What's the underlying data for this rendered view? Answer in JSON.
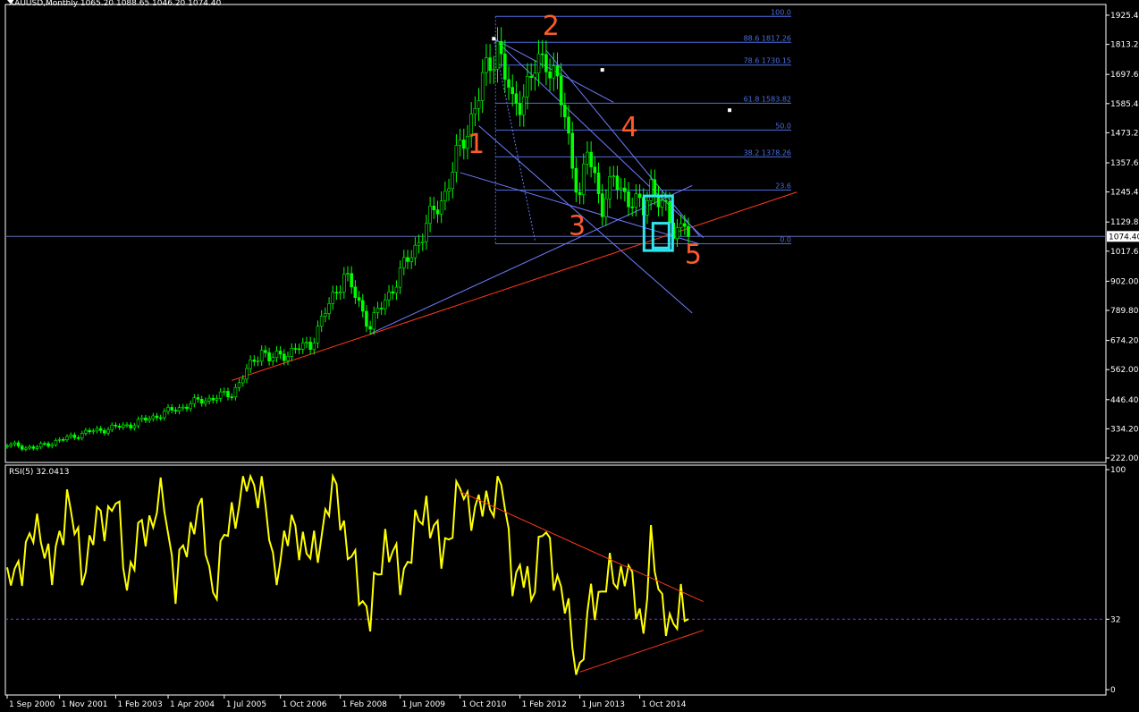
{
  "header": {
    "symbol_line": "XAUUSD,Monthly  1065.20 1088.65 1046.20 1074.40",
    "rsi_line": "RSI(5) 32.0413"
  },
  "colors": {
    "background": "#000000",
    "grid_and_axis": "#ffffff",
    "bull_candle": "#00ff00",
    "bear_candle": "#00ff00",
    "fib_lines": "#4a6ee0",
    "trend_lines": "#6f7dff",
    "support_line": "#ff3a1a",
    "rsi_line": "#ffff00",
    "rsi_trend_lines": "#ff3a1a",
    "wave_labels": "#ff5a2a",
    "highlight_boxes": "#2ee6f0",
    "price_marker_bg": "#ffffff",
    "price_marker_text": "#000000"
  },
  "chart_data": [
    {
      "type": "candlestick",
      "symbol": "XAUUSD",
      "timeframe": "Monthly",
      "current": {
        "open": 1065.2,
        "high": 1088.65,
        "low": 1046.2,
        "close": 1074.4
      },
      "y_ticks": [
        "1925.40",
        "1813.20",
        "1697.60",
        "1585.40",
        "1473.20",
        "1357.60",
        "1245.40",
        "1129.80",
        "1017.60",
        "902.00",
        "789.80",
        "674.20",
        "562.00",
        "446.40",
        "334.20",
        "222.00"
      ],
      "price_marker": "1074.40",
      "x_ticks": [
        "1 Sep 2000",
        "1 Nov 2001",
        "1 Feb 2003",
        "1 Apr 2004",
        "1 Jul 2005",
        "1 Oct 2006",
        "1 Feb 2008",
        "1 Jun 2009",
        "1 Oct 2010",
        "1 Feb 2012",
        "1 Jun 2013",
        "1 Oct 2014"
      ],
      "x_range": [
        "2000-09",
        "2015-11"
      ],
      "y_range": [
        222.0,
        1925.4
      ],
      "key_points": [
        {
          "date": "2000-09",
          "close": 273
        },
        {
          "date": "2001-04",
          "close": 260
        },
        {
          "date": "2002-06",
          "close": 320
        },
        {
          "date": "2003-06",
          "close": 350
        },
        {
          "date": "2004-12",
          "close": 440
        },
        {
          "date": "2005-09",
          "close": 470
        },
        {
          "date": "2006-05",
          "close": 640
        },
        {
          "date": "2006-07",
          "close": 600
        },
        {
          "date": "2007-06",
          "close": 660
        },
        {
          "date": "2008-03",
          "close": 930
        },
        {
          "date": "2008-10",
          "close": 730
        },
        {
          "date": "2009-06",
          "close": 930
        },
        {
          "date": "2010-06",
          "close": 1245
        },
        {
          "date": "2011-08",
          "close": 1825
        },
        {
          "date": "2011-12",
          "close": 1565
        },
        {
          "date": "2012-09",
          "close": 1775
        },
        {
          "date": "2012-12",
          "close": 1660
        },
        {
          "date": "2013-06",
          "close": 1225
        },
        {
          "date": "2013-08",
          "close": 1395
        },
        {
          "date": "2013-12",
          "close": 1200
        },
        {
          "date": "2014-03",
          "close": 1285
        },
        {
          "date": "2014-11",
          "close": 1170
        },
        {
          "date": "2015-01",
          "close": 1285
        },
        {
          "date": "2015-07",
          "close": 1095
        },
        {
          "date": "2015-10",
          "close": 1140
        },
        {
          "date": "2015-11",
          "close": 1074.4
        }
      ],
      "fibonacci_levels": [
        {
          "label": "100.0"
        },
        {
          "label": "88.6 1817.26"
        },
        {
          "label": "78.6 1730.15"
        },
        {
          "label": "61.8 1583.82"
        },
        {
          "label": "50.0"
        },
        {
          "label": "38.2 1378.26"
        },
        {
          "label": "23.6"
        },
        {
          "label": "0.0"
        }
      ],
      "wave_labels": [
        "1",
        "2",
        "3",
        "4",
        "5"
      ]
    },
    {
      "type": "line",
      "indicator": "RSI",
      "period": 5,
      "last_value": 32.0413,
      "y_range": [
        0,
        100
      ],
      "y_ticks": [
        "100",
        "32",
        "0"
      ],
      "reference_level": 32,
      "key_points": [
        {
          "date": "2000-09",
          "value": 45
        },
        {
          "date": "2001-01",
          "value": 60
        },
        {
          "date": "2001-06",
          "value": 75
        },
        {
          "date": "2001-09",
          "value": 50
        },
        {
          "date": "2002-01",
          "value": 88
        },
        {
          "date": "2002-05",
          "value": 55
        },
        {
          "date": "2002-09",
          "value": 75
        },
        {
          "date": "2003-02",
          "value": 85
        },
        {
          "date": "2003-05",
          "value": 50
        },
        {
          "date": "2003-09",
          "value": 72
        },
        {
          "date": "2004-03",
          "value": 86
        },
        {
          "date": "2004-06",
          "value": 48
        },
        {
          "date": "2004-12",
          "value": 85
        },
        {
          "date": "2005-04",
          "value": 45
        },
        {
          "date": "2005-09",
          "value": 80
        },
        {
          "date": "2006-01",
          "value": 93
        },
        {
          "date": "2006-05",
          "value": 95
        },
        {
          "date": "2006-08",
          "value": 55
        },
        {
          "date": "2007-02",
          "value": 75
        },
        {
          "date": "2007-06",
          "value": 58
        },
        {
          "date": "2008-01",
          "value": 93
        },
        {
          "date": "2008-04",
          "value": 63
        },
        {
          "date": "2008-10",
          "value": 32
        },
        {
          "date": "2009-02",
          "value": 70
        },
        {
          "date": "2009-06",
          "value": 50
        },
        {
          "date": "2010-01",
          "value": 85
        },
        {
          "date": "2010-05",
          "value": 60
        },
        {
          "date": "2010-10",
          "value": 90
        },
        {
          "date": "2011-03",
          "value": 80
        },
        {
          "date": "2011-09",
          "value": 93
        },
        {
          "date": "2011-12",
          "value": 55
        },
        {
          "date": "2012-05",
          "value": 45
        },
        {
          "date": "2012-08",
          "value": 72
        },
        {
          "date": "2012-12",
          "value": 52
        },
        {
          "date": "2013-06",
          "value": 8
        },
        {
          "date": "2013-09",
          "value": 40
        },
        {
          "date": "2014-01",
          "value": 48
        },
        {
          "date": "2014-06",
          "value": 55
        },
        {
          "date": "2014-11",
          "value": 30
        },
        {
          "date": "2015-01",
          "value": 62
        },
        {
          "date": "2015-05",
          "value": 35
        },
        {
          "date": "2015-07",
          "value": 22
        },
        {
          "date": "2015-09",
          "value": 44
        },
        {
          "date": "2015-11",
          "value": 32.04
        }
      ]
    }
  ]
}
